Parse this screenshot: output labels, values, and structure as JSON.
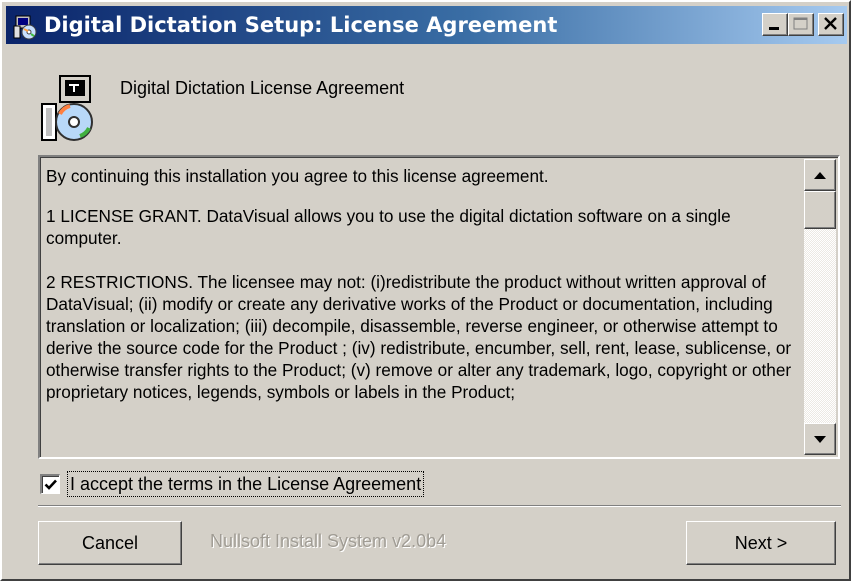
{
  "window": {
    "title": "Digital Dictation Setup: License Agreement",
    "title_icon": "installer-icon",
    "titlebar_gradient": [
      "#0a246a",
      "#a6caf0"
    ]
  },
  "header": {
    "title": "Digital Dictation License Agreement",
    "icon": "install-disk-icon"
  },
  "license": {
    "intro": "By  continuing this installation you agree to this license agreement.",
    "grant": "1 LICENSE GRANT. DataVisual allows you to use the digital dictation software on a single computer.",
    "restrictions": "2 RESTRICTIONS. The licensee may not: (i)redistribute the product without written approval of DataVisual; (ii)  modify or create any derivative works of the Product or documentation, including translation or localization; (iii) decompile, disassemble, reverse engineer, or otherwise attempt to derive the source code for the Product ; (iv) redistribute, encumber, sell, rent, lease, sublicense, or otherwise transfer rights to the Product; (v) remove or alter any trademark, logo, copyright or other proprietary notices, legends, symbols or labels in the Product;"
  },
  "accept": {
    "checked": true,
    "label": "I accept the terms in the License Agreement"
  },
  "buttons": {
    "cancel": "Cancel",
    "next": "Next >"
  },
  "footer": {
    "branding": "Nullsoft Install System v2.0b4"
  }
}
